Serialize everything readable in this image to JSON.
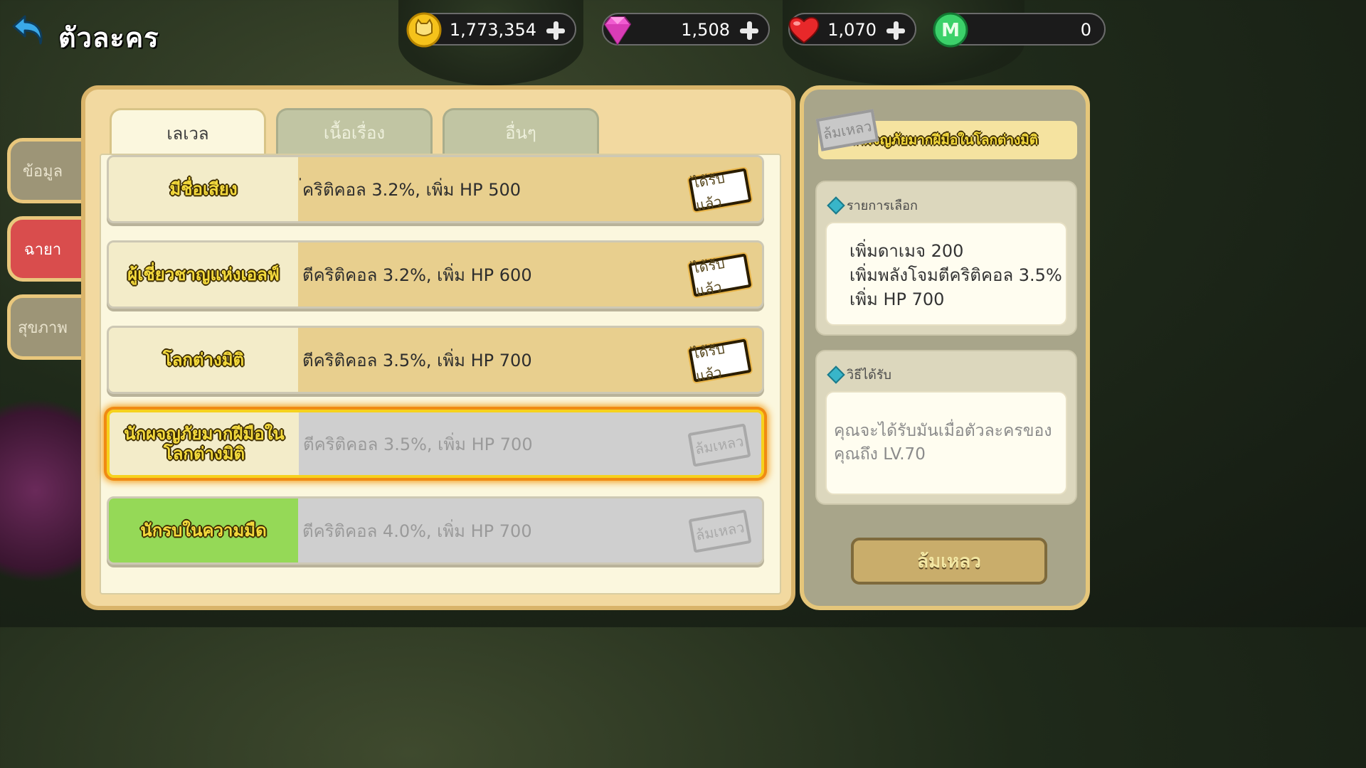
{
  "header": {
    "title": "ตัวละคร",
    "back_icon": "back-arrow-icon"
  },
  "currencies": [
    {
      "icon": "cat-coin-icon",
      "value": "1,773,354",
      "has_plus": true
    },
    {
      "icon": "gem-icon",
      "value": "1,508",
      "has_plus": true
    },
    {
      "icon": "heart-icon",
      "value": "1,070",
      "has_plus": true
    },
    {
      "icon": "m-coin-icon",
      "value": "0",
      "has_plus": false
    }
  ],
  "side_tabs": [
    {
      "label": "ข้อมูล",
      "active": false
    },
    {
      "label": "ฉายา",
      "active": true
    },
    {
      "label": "สุขภาพ",
      "active": false
    }
  ],
  "tabs": [
    {
      "label": "เลเวล",
      "active": true
    },
    {
      "label": "เนื้อเรื่อง",
      "active": false
    },
    {
      "label": "อื่นๆ",
      "active": false
    }
  ],
  "titles": [
    {
      "name": "มีชื่อเสียง",
      "bonus": "่คริติคอล 3.2%, เพิ่ม HP 500",
      "status": "ได้รับแล้ว"
    },
    {
      "name": "ผู้เชี่ยวชาญแห่งเอลฟ์",
      "bonus": "ตีคริติคอล 3.2%, เพิ่ม HP 600",
      "status": "ได้รับแล้ว"
    },
    {
      "name": "โลกต่างมิติ",
      "bonus": "ตีคริติคอล 3.5%, เพิ่ม HP 700",
      "status": "ได้รับแล้ว"
    },
    {
      "name": "นักผจญภัยมากฝีมือในโลกต่างมิติ",
      "bonus": "ตีคริติคอล 3.5%, เพิ่ม HP 700",
      "status": "ล้มเหลว"
    },
    {
      "name": "นักรบในความมืด",
      "bonus": "ตีคริติคอล 4.0%, เพิ่ม HP 700",
      "status": "ล้มเหลว"
    }
  ],
  "detail": {
    "stamp": "ล้มเหลว",
    "title": "นักผจญภัยมากฝีมือในโลกต่างมิติ",
    "options_heading": "รายการเลือก",
    "options": [
      "เพิ่มดาเมจ 200",
      "เพิ่มพลังโจมตีคริติคอล 3.5%",
      "เพิ่ม HP 700"
    ],
    "how_heading": "วิธีได้รับ",
    "how_text": "คุณจะได้รับมันเมื่อตัวละครของคุณถึง LV.70",
    "button_label": "ล้มเหลว"
  },
  "colors": {
    "active_side_tab": "#d94d4d",
    "panel_border": "#d9b46a",
    "selected_glow": "#f08a13",
    "green_row": "#95d957"
  }
}
